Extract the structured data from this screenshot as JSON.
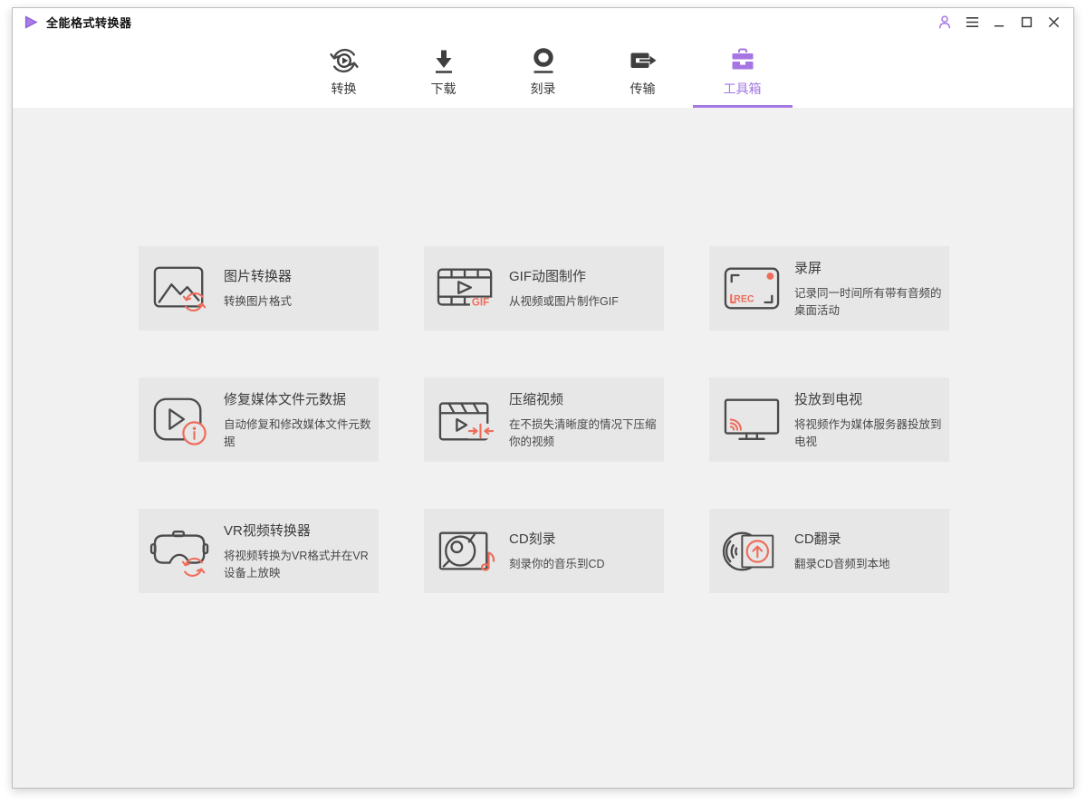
{
  "app": {
    "title": "全能格式转换器",
    "accent_purple": "#a477e2",
    "accent_coral": "#ed6d5c",
    "content_bg": "#f1f1f1",
    "card_bg": "#e8e7e7"
  },
  "titlebar": {
    "icons": [
      "user-icon",
      "hamburger-icon",
      "minimize-icon",
      "maximize-icon",
      "close-icon"
    ]
  },
  "nav": {
    "tabs": [
      {
        "label": "转换",
        "icon": "convert-icon",
        "active": false
      },
      {
        "label": "下载",
        "icon": "download-icon",
        "active": false
      },
      {
        "label": "刻录",
        "icon": "burn-icon",
        "active": false
      },
      {
        "label": "传输",
        "icon": "transfer-icon",
        "active": false
      },
      {
        "label": "工具箱",
        "icon": "toolbox-icon",
        "active": true
      }
    ]
  },
  "toolbox": {
    "cards": [
      {
        "title": "图片转换器",
        "subtitle": "转换图片格式",
        "icon": "image-converter-icon"
      },
      {
        "title": "GIF动图制作",
        "subtitle": "从视频或图片制作GIF",
        "icon": "gif-maker-icon",
        "badge": "GIF"
      },
      {
        "title": "录屏",
        "subtitle": "记录同一时间所有带有音频的桌面活动",
        "icon": "screen-record-icon",
        "badge": "REC"
      },
      {
        "title": "修复媒体文件元数据",
        "subtitle": "自动修复和修改媒体文件元数据",
        "icon": "fix-metadata-icon"
      },
      {
        "title": "压缩视频",
        "subtitle": "在不损失清晰度的情况下压缩你的视频",
        "icon": "compress-video-icon"
      },
      {
        "title": "投放到电视",
        "subtitle": "将视频作为媒体服务器投放到电视",
        "icon": "cast-to-tv-icon"
      },
      {
        "title": "VR视频转换器",
        "subtitle": "将视频转换为VR格式并在VR设备上放映",
        "icon": "vr-converter-icon"
      },
      {
        "title": "CD刻录",
        "subtitle": "刻录你的音乐到CD",
        "icon": "cd-burn-icon"
      },
      {
        "title": "CD翻录",
        "subtitle": "翻录CD音频到本地",
        "icon": "cd-rip-icon"
      }
    ]
  }
}
